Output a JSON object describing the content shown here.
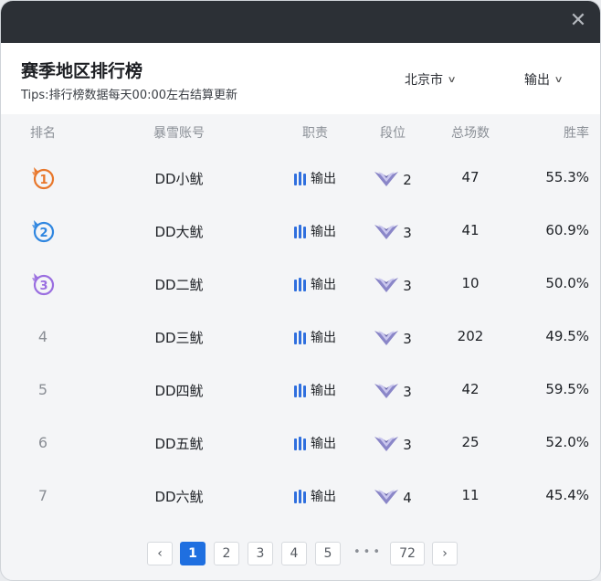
{
  "header": {
    "title": "赛季地区排行榜",
    "tips": "Tips:排行榜数据每天00:00左右结算更新",
    "region_dropdown": "北京市",
    "role_dropdown": "输出"
  },
  "table": {
    "columns": [
      "排名",
      "暴雪账号",
      "职责",
      "段位",
      "总场数",
      "胜率"
    ],
    "rows": [
      {
        "rank": "1",
        "name": "DD小鱿",
        "role": "输出",
        "tier": "2",
        "total": "47",
        "winrate": "55.3%"
      },
      {
        "rank": "2",
        "name": "DD大鱿",
        "role": "输出",
        "tier": "3",
        "total": "41",
        "winrate": "60.9%"
      },
      {
        "rank": "3",
        "name": "DD二鱿",
        "role": "输出",
        "tier": "3",
        "total": "10",
        "winrate": "50.0%"
      },
      {
        "rank": "4",
        "name": "DD三鱿",
        "role": "输出",
        "tier": "3",
        "total": "202",
        "winrate": "49.5%"
      },
      {
        "rank": "5",
        "name": "DD四鱿",
        "role": "输出",
        "tier": "3",
        "total": "42",
        "winrate": "59.5%"
      },
      {
        "rank": "6",
        "name": "DD五鱿",
        "role": "输出",
        "tier": "3",
        "total": "25",
        "winrate": "52.0%"
      },
      {
        "rank": "7",
        "name": "DD六鱿",
        "role": "输出",
        "tier": "4",
        "total": "11",
        "winrate": "45.4%"
      }
    ]
  },
  "pagination": {
    "prev": "‹",
    "pages": [
      "1",
      "2",
      "3",
      "4",
      "5"
    ],
    "ellipsis": "•••",
    "last": "72",
    "next": "›",
    "current": "1"
  },
  "colors": {
    "titlebar": "#2c3036",
    "accent": "#1f6fe0",
    "gold_medal": "#e8772b",
    "silver_medal": "#2f86e0",
    "bronze_medal": "#9a6ee0"
  },
  "icons": {
    "close": "close-icon",
    "chevron": "chevron-down-icon",
    "role": "damage-role-icon",
    "tier": "rank-wings-icon",
    "medal": "rank-medal-icon"
  }
}
